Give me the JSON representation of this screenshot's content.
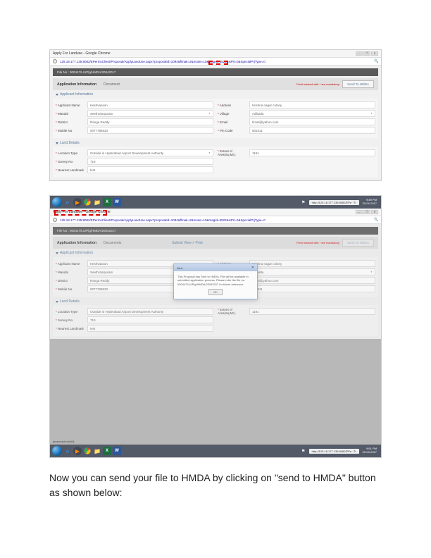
{
  "window": {
    "title": "Apply For Landuse - Google Chrome",
    "min": "—",
    "max": "❐",
    "close": "✕"
  },
  "url": {
    "secure_icon": "ⓘ",
    "text": "125.18.177.135:8082/EPermsClient/Proposal/ApplyLandUse.aspx?proposalId=1094&flmak=2&mode=10&magId=5522&isPrl=0&SpecialPrjType=0",
    "search_icon": "🔍"
  },
  "banner": "File No : 000447/LU/Plg/HMDA/20042017",
  "tabs": {
    "active": "Application Information",
    "inactive": "Document",
    "red_note": "Field marked with * are mandatory",
    "send_btn": "Send To HMDA"
  },
  "tabs2_inactive": "Documents",
  "tabs2_center": "Submit View > Print",
  "sections": {
    "applicant": "Applicant Information",
    "land": "Land Details"
  },
  "form": {
    "applicant_name": {
      "label": "Applicant Name",
      "value": "Keshvasaon"
    },
    "mandal": {
      "label": "Mandal",
      "value": "Seethrampuram"
    },
    "district": {
      "label": "District",
      "value": "Ranga Reddy"
    },
    "mobile": {
      "label": "Mobile No",
      "value": "0077788533"
    },
    "address": {
      "label": "Address",
      "value": "Krishna nagar colony"
    },
    "village": {
      "label": "Village",
      "value": "Adibatla"
    },
    "email": {
      "label": "Email",
      "value": "kmati@yahoo.com"
    },
    "pincode": {
      "label": "Pin Code",
      "value": "501511"
    },
    "location_type": {
      "label": "Location Type",
      "value": "Outside in Hyderabad Airport Development Authority"
    },
    "survey": {
      "label": "Survey No",
      "value": "719"
    },
    "landmark": {
      "label": "Nearest Landmark",
      "value": "test"
    },
    "extent": {
      "label": "Extent of Area(Sq.Mt.)",
      "value": "1191"
    }
  },
  "modal": {
    "title": "Alert",
    "body": "This Proposal has Sent to HMDA. File will be available in submitted application process. Please refer the file no. 000447/LU/Plg/HMDA/20042017 for future reference.",
    "ok": "OK",
    "close": "✕"
  },
  "taskbar": {
    "ie": "e",
    "wmp": "▶",
    "chrome_colors": "●",
    "fm": "📁",
    "excel": "X",
    "word": "W",
    "flag_icon": "⚑",
    "addr": "http://125.18.177.135:8082/EPe",
    "refresh": "↻",
    "time1": "9:49 PM",
    "date1": "20-04-2017",
    "time2": "9:51 PM",
    "date2": "20-04-2017"
  },
  "status": "javascript:void(0);",
  "caption": "Now you can send your file to HMDA by clicking on \"send to HMDA\" button as shown below:"
}
